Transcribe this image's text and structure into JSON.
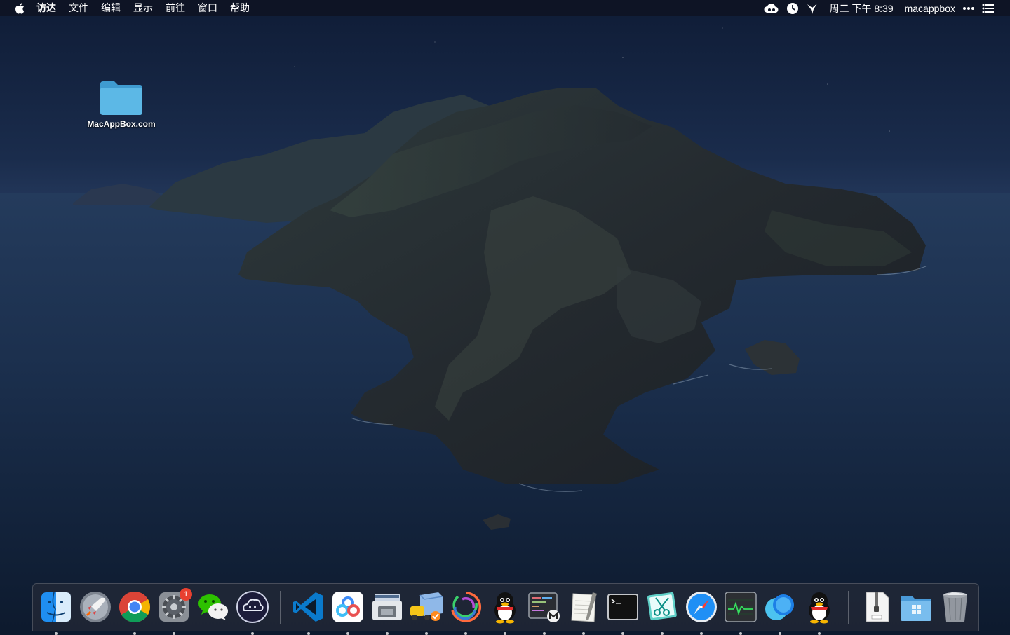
{
  "menubar": {
    "apple_icon": "apple-logo-icon",
    "items": [
      "访达",
      "文件",
      "编辑",
      "显示",
      "前往",
      "窗口",
      "帮助"
    ],
    "status_icons": [
      "cloud-sync-icon",
      "time-machine-icon",
      "vpn-bird-icon"
    ],
    "clock": "周二 下午 8:39",
    "username": "macappbox",
    "more_icon": "more-dots-icon",
    "notification_icon": "notification-center-icon"
  },
  "desktop": {
    "folder_label": "MacAppBox.com",
    "folder_icon": "folder-icon"
  },
  "dock": {
    "badge_system_preferences": "1",
    "apps": [
      {
        "name": "finder",
        "icon": "finder-icon",
        "running": true
      },
      {
        "name": "launchpad",
        "icon": "launchpad-rocket-icon",
        "running": false
      },
      {
        "name": "chrome",
        "icon": "chrome-icon",
        "running": true
      },
      {
        "name": "system-preferences",
        "icon": "gear-icon",
        "running": true
      },
      {
        "name": "wechat",
        "icon": "wechat-icon",
        "running": false
      },
      {
        "name": "app-cleaner",
        "icon": "cloud-face-icon",
        "running": true
      },
      {
        "name": "vscode",
        "icon": "vscode-icon",
        "running": true
      },
      {
        "name": "baidu-netdisk",
        "icon": "baidu-netdisk-icon",
        "running": true
      },
      {
        "name": "disk-utility",
        "icon": "printer-disk-icon",
        "running": true
      },
      {
        "name": "transmit",
        "icon": "delivery-truck-icon",
        "running": true
      },
      {
        "name": "affinity",
        "icon": "color-rings-icon",
        "running": true
      },
      {
        "name": "qq",
        "icon": "qq-penguin-icon",
        "running": true
      },
      {
        "name": "code-editor",
        "icon": "code-m-icon",
        "running": true
      },
      {
        "name": "textedit",
        "icon": "notes-paper-icon",
        "running": true
      },
      {
        "name": "terminal",
        "icon": "terminal-icon",
        "running": true
      },
      {
        "name": "scissors-app",
        "icon": "scissors-icon",
        "running": true
      },
      {
        "name": "safari",
        "icon": "safari-compass-icon",
        "running": true
      },
      {
        "name": "activity-monitor",
        "icon": "activity-monitor-icon",
        "running": true
      },
      {
        "name": "messenger",
        "icon": "chat-bubbles-icon",
        "running": true
      },
      {
        "name": "qq-2",
        "icon": "qq-penguin-icon",
        "running": true
      },
      {
        "name": "archive",
        "icon": "zip-archive-icon",
        "running": false
      },
      {
        "name": "folder",
        "icon": "windows-folder-icon",
        "running": false
      },
      {
        "name": "trash",
        "icon": "trash-icon",
        "running": false
      }
    ]
  },
  "colors": {
    "menubar_bg": "#0e1424",
    "dock_bg": "#282c38",
    "badge": "#e8402f",
    "folder": "#5cb8e6"
  }
}
